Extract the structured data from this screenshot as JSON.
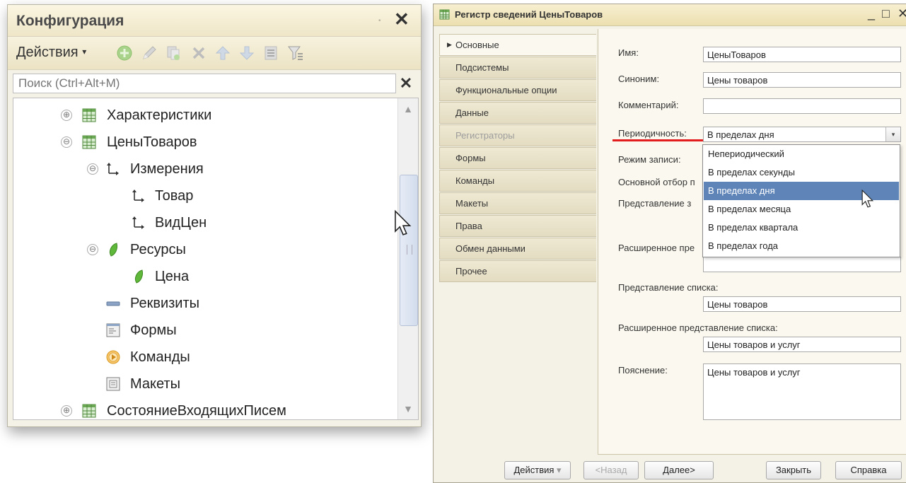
{
  "config_panel": {
    "title": "Конфигурация",
    "pin_glyph": "•",
    "close_glyph": "✕",
    "actions_label": "Действия",
    "actions_arrow": "▾",
    "search_placeholder": "Поиск (Ctrl+Alt+M)",
    "search_clear": "✕",
    "toolbar_icons": [
      "add-icon",
      "edit-icon",
      "copy-icon",
      "delete-icon",
      "move-up-icon",
      "move-down-icon",
      "list-icon",
      "filter-icon"
    ],
    "tree": [
      {
        "label": "Характеристики",
        "icon": "table-icon",
        "toggle": "⊕"
      },
      {
        "label": "ЦеныТоваров",
        "icon": "table-icon",
        "toggle": "⊖"
      },
      {
        "label": "Измерения",
        "icon": "dimension-icon",
        "toggle": "⊖"
      },
      {
        "label": "Товар",
        "icon": "dimension-icon"
      },
      {
        "label": "ВидЦен",
        "icon": "dimension-icon"
      },
      {
        "label": "Ресурсы",
        "icon": "resource-leaf-icon",
        "toggle": "⊖"
      },
      {
        "label": "Цена",
        "icon": "resource-leaf-icon"
      },
      {
        "label": "Реквизиты",
        "icon": "attribute-icon"
      },
      {
        "label": "Формы",
        "icon": "form-icon"
      },
      {
        "label": "Команды",
        "icon": "command-icon"
      },
      {
        "label": "Макеты",
        "icon": "template-icon"
      },
      {
        "label": "СостояниеВходящихПисем",
        "icon": "table-icon",
        "toggle": "⊕"
      }
    ],
    "scroll_up": "▲",
    "scroll_down": "▼"
  },
  "register_window": {
    "title": "Регистр сведений ЦеныТоваров",
    "minimize": "_",
    "maximize": "□",
    "close": "✕",
    "tabs": [
      {
        "label": "Основные",
        "active": true
      },
      {
        "label": "Подсистемы"
      },
      {
        "label": "Функциональные опции"
      },
      {
        "label": "Данные"
      },
      {
        "label": "Регистраторы",
        "disabled": true
      },
      {
        "label": "Формы"
      },
      {
        "label": "Команды"
      },
      {
        "label": "Макеты"
      },
      {
        "label": "Права"
      },
      {
        "label": "Обмен данными"
      },
      {
        "label": "Прочее"
      }
    ],
    "tab_active_marker": "▶",
    "fields": {
      "name_label": "Имя:",
      "name_value": "ЦеныТоваров",
      "synonym_label": "Синоним:",
      "synonym_value": "Цены товаров",
      "comment_label": "Комментарий:",
      "comment_value": "",
      "periodicity_label": "Периодичность:",
      "periodicity_value": "В пределах дня",
      "write_mode_label": "Режим записи:",
      "main_filter_label": "Основной отбор п",
      "object_repr_label": "Представление з",
      "ext_object_repr_label": "Расширенное пре",
      "list_repr_label": "Представление списка:",
      "list_repr_value": "Цены товаров",
      "ext_list_repr_label": "Расширенное представление списка:",
      "ext_list_repr_value": "Цены товаров и услуг",
      "explanation_label": "Пояснение:",
      "explanation_value": "Цены товаров и услуг"
    },
    "dropdown_arrow": "▾",
    "periodicity_options": [
      "Непериодический",
      "В пределах секунды",
      "В пределах дня",
      "В пределах месяца",
      "В пределах квартала",
      "В пределах года"
    ],
    "periodicity_selected_index": 2,
    "buttons": {
      "actions": "Действия",
      "actions_arrow": "▾",
      "back": "<Назад",
      "next": "Далее>",
      "close": "Закрыть",
      "help": "Справка"
    }
  },
  "colors": {
    "highlight": "#5e84b8",
    "underline": "#e31d1d",
    "panel_bg": "#f4f1e6"
  }
}
